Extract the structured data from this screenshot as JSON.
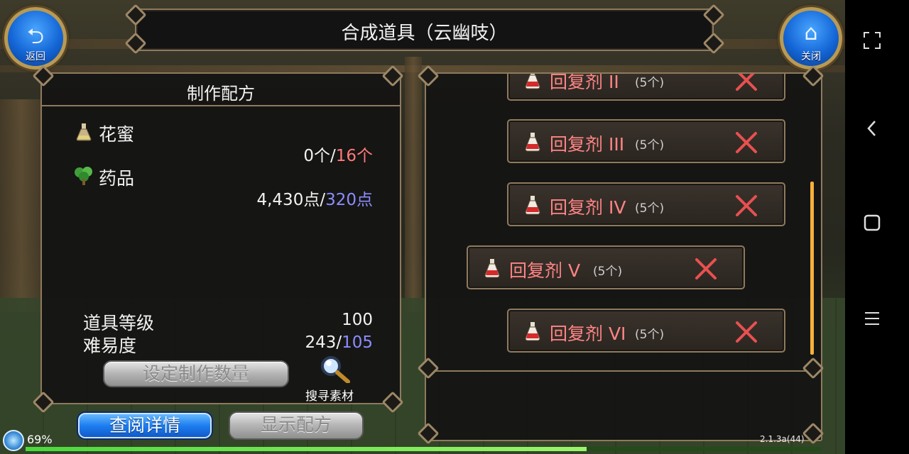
{
  "window": {
    "title": "合成道具（云幽吱）"
  },
  "nav": {
    "back_label": "返回",
    "close_label": "关闭"
  },
  "recipe_panel": {
    "header": "制作配方",
    "ingredients": [
      {
        "name": "花蜜",
        "icon": "flask-icon",
        "owned": "0个",
        "separator": "/",
        "required": "16个"
      },
      {
        "name": "药品",
        "icon": "herb-icon",
        "owned": "4,430点",
        "separator": "/",
        "required": "320点"
      }
    ],
    "item_level_label": "道具等级",
    "item_level_value": "100",
    "difficulty_label": "难易度",
    "difficulty_value": "243",
    "difficulty_separator": "/",
    "difficulty_required": "105",
    "set_quantity_button": "设定制作数量",
    "search_materials_label": "搜寻素材"
  },
  "bottom_buttons": {
    "view_details": "查阅详情",
    "show_recipe": "显示配方"
  },
  "item_list": [
    {
      "name": "回复剂 II",
      "count": "(5个)"
    },
    {
      "name": "回复剂 III",
      "count": "(5个)"
    },
    {
      "name": "回复剂 IV",
      "count": "(5个)"
    },
    {
      "name": "回复剂 V",
      "count": "(5个)",
      "selected": true
    },
    {
      "name": "回复剂 VI",
      "count": "(5个)"
    }
  ],
  "status": {
    "battery": "69%",
    "version": "2.1.3a(44)",
    "progress": 0.705
  },
  "colors": {
    "required_red": "#ff7a7a",
    "required_blue": "#8c8cff",
    "item_name": "#ff8585",
    "frame_gold": "#8e7a5e"
  }
}
